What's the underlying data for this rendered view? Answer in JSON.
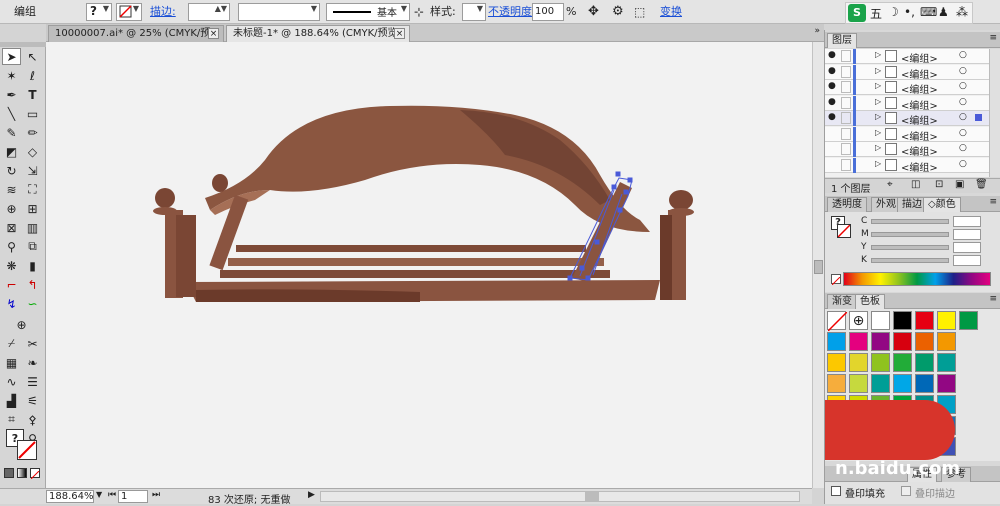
{
  "toolbar": {
    "selection_label": "编组",
    "stroke_label": "描边:",
    "stroke_profile": "基本",
    "style_label": "样式:",
    "opacity_label": "不透明度:",
    "opacity_value": "100",
    "opacity_unit": "%",
    "transform_link": "变换"
  },
  "tabs": [
    {
      "label": "10000007.ai* @ 25% (CMYK/预览)"
    },
    {
      "label": "未标题-1* @ 188.64% (CMYK/预览)"
    }
  ],
  "status": {
    "zoom": "188.64%",
    "page": "1",
    "history": "83 次还原; 无重做"
  },
  "ime": {
    "mode": "五"
  },
  "layers": {
    "title": "图层",
    "rows": [
      {
        "name": "<编组>"
      },
      {
        "name": "<编组>"
      },
      {
        "name": "<编组>"
      },
      {
        "name": "<编组>"
      },
      {
        "name": "<编组>"
      },
      {
        "name": "<编组>"
      },
      {
        "name": "<编组>"
      },
      {
        "name": "<编组>"
      }
    ],
    "count": "1 个图层"
  },
  "color_panel": {
    "tabs": [
      "透明度",
      "外观",
      "描边",
      "颜色"
    ],
    "channels": [
      "C",
      "M",
      "Y",
      "K"
    ],
    "values": [
      "",
      "",
      "",
      ""
    ]
  },
  "swatch_panel": {
    "tabs": [
      "渐变",
      "色板"
    ],
    "colors": [
      [
        "#ffffff",
        "#000000",
        "#e60012",
        "#fff100",
        "#009944",
        "#1d2088"
      ],
      [
        "#00a0e9",
        "#e4007f",
        "#920783",
        "#d7000f",
        "#eb6100",
        "#f39800"
      ],
      [
        "#fcc800",
        "#e2d52c",
        "#8fc31f",
        "#22ac38",
        "#009b6b",
        "#009e96"
      ],
      [
        "#f6ad3c",
        "#c6d93e",
        "#009e96",
        "#00a7e7",
        "#0068b7",
        "#920783"
      ],
      [
        "#fdd000",
        "#cfdb00",
        "#6ab42d",
        "#00a73c",
        "#008f8c",
        "#00a0c6"
      ],
      [
        "#f0e442",
        "#a5c535",
        "#3aaa35",
        "#0f9e4b",
        "#1c9aa8",
        "#1a6fb5"
      ],
      [
        "#f5a623",
        "#cddc39",
        "#4caf50",
        "#009688",
        "#03a9f4",
        "#3f51b5"
      ]
    ]
  },
  "bottom_panel": {
    "tabs": [
      "属性",
      "参考"
    ],
    "overprint_fill": "叠印填充",
    "overprint_stroke": "叠印描边"
  },
  "watermark": "n.baidu.com"
}
